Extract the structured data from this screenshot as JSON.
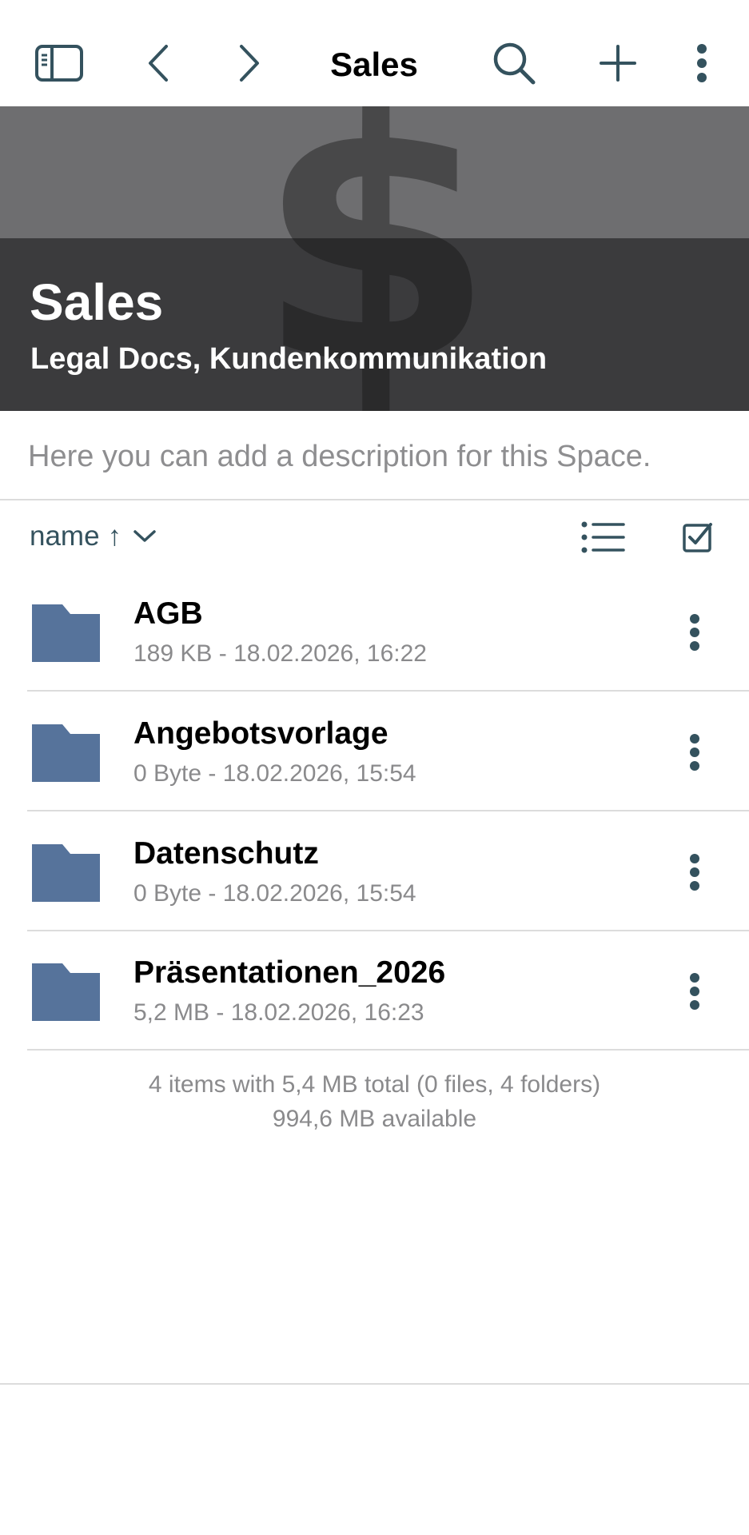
{
  "navbar": {
    "title": "Sales",
    "icons": {
      "sidebar": "sidebar-icon",
      "back": "chevron-left-icon",
      "forward": "chevron-right-icon",
      "search": "search-icon",
      "add": "plus-icon",
      "more": "more-vertical-icon"
    }
  },
  "banner": {
    "title": "Sales",
    "subtitle": "Legal Docs, Kundenkommunikation",
    "glyph": "$"
  },
  "description": {
    "placeholder": "Here you can add a description for this Space."
  },
  "sort": {
    "label": "name",
    "direction": "↑",
    "icons": {
      "dropdown": "chevron-down-icon",
      "list_view": "list-icon",
      "select": "checkbox-checked-icon"
    }
  },
  "items": [
    {
      "name": "AGB",
      "meta": "189 KB - 18.02.2026, 16:22",
      "icon": "folder-icon"
    },
    {
      "name": "Angebotsvorlage",
      "meta": "0 Byte - 18.02.2026, 15:54",
      "icon": "folder-icon"
    },
    {
      "name": "Datenschutz",
      "meta": "0 Byte - 18.02.2026, 15:54",
      "icon": "folder-icon"
    },
    {
      "name": "Präsentationen_2026",
      "meta": "5,2 MB - 18.02.2026, 16:23",
      "icon": "folder-icon"
    }
  ],
  "footer": {
    "summary": "4 items with 5,4 MB total (0 files, 4 folders)",
    "available": "994,6 MB available"
  },
  "colors": {
    "accent": "#34525e",
    "folder": "#56739b",
    "banner_light": "#6e6e70",
    "banner_dark": "#3b3b3d",
    "secondary_text": "#8a8a8c",
    "divider": "#dcdcdc"
  }
}
